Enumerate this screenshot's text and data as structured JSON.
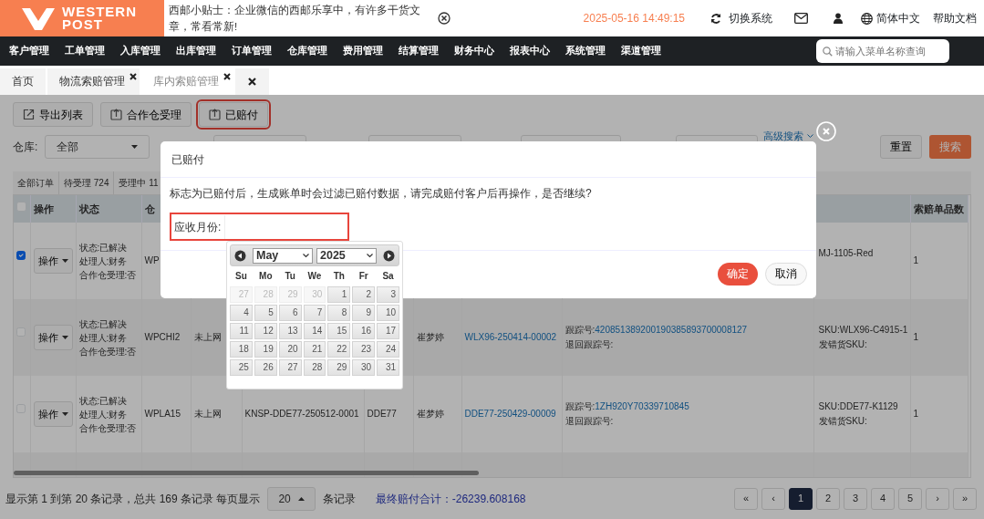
{
  "header": {
    "logo_line1": "WESTERN",
    "logo_line2": "POST",
    "tip": "西邮小贴士：企业微信的西邮乐享中，有许多干货文章，常看常新!",
    "datetime": "2025-05-16 14:49:15",
    "switch_system": "切换系统",
    "language": "简体中文",
    "help": "帮助文档"
  },
  "menu": [
    "客户管理",
    "工单管理",
    "入库管理",
    "出库管理",
    "订单管理",
    "仓库管理",
    "费用管理",
    "结算管理",
    "财务中心",
    "报表中心",
    "系统管理",
    "渠道管理"
  ],
  "menu_search": {
    "placeholder": "请输入菜单名称查询"
  },
  "page_tabs": [
    {
      "kind": "page",
      "label": "首页",
      "closable": false,
      "selected": false
    },
    {
      "kind": "page",
      "label": "物流索赔管理",
      "closable": true,
      "selected": false
    },
    {
      "kind": "page",
      "label": "库内索赔管理",
      "closable": true,
      "selected": true
    },
    {
      "kind": "close",
      "selected": false
    }
  ],
  "toolbar": [
    {
      "label": "导出列表",
      "highlighted": false
    },
    {
      "label": "合作仓受理",
      "highlighted": false
    },
    {
      "label": "已赔付",
      "highlighted": true
    }
  ],
  "filters": {
    "warehouse_label": "仓库:",
    "warehouse_value": "全部",
    "advanced_search": "高级搜索",
    "reset": "重置",
    "search": "搜索"
  },
  "status_tabs": [
    "全部订单",
    "待受理 724",
    "受理中 11"
  ],
  "table": {
    "select_all_checked": false,
    "columns": [
      null,
      "操作",
      "状态",
      "仓",
      null,
      null,
      null,
      null,
      null,
      null,
      null,
      "索赔单品数"
    ],
    "rows": [
      {
        "checked": true,
        "action": "操作",
        "status_lines": [
          "状态:已解决",
          "处理人:财务",
          "合作仓受理:否"
        ],
        "warehouse": "WP",
        "sku_lines": [
          "MJ-1105-Red"
        ],
        "qty": "1"
      },
      {
        "checked": false,
        "action": "操作",
        "status_lines": [
          "状态:已解决",
          "处理人:财务",
          "合作仓受理:否"
        ],
        "warehouse": "WPCHI2",
        "online": "未上网",
        "customer": "崔梦婷",
        "order_no": "WLX96-250414-00002",
        "tracking_label": "跟踪号:",
        "tracking_no": "420851389200190385893700008127",
        "return_label": "退回跟踪号:",
        "sku_lines": [
          "SKU:WLX96-C4915-1",
          "发错货SKU:"
        ],
        "qty": "1"
      },
      {
        "checked": false,
        "action": "操作",
        "status_lines": [
          "状态:已解决",
          "处理人:财务",
          "合作仓受理:否"
        ],
        "warehouse": "WPLA15",
        "online": "未上网",
        "claim_no": "KNSP-DDE77-250512-0001",
        "client": "DDE77",
        "customer": "崔梦婷",
        "order_no": "DDE77-250429-00009",
        "tracking_label": "跟踪号:",
        "tracking_no": "1ZH920Y70339710845",
        "return_label": "退回跟踪号:",
        "sku_lines": [
          "SKU:DDE77-K1129",
          "发错货SKU:"
        ],
        "qty": "1"
      }
    ]
  },
  "footer": {
    "summary_before": "显示第 1 到第 20 条记录，总共 169 条记录 每页显示",
    "page_size": "20",
    "summary_after": "条记录",
    "total": "最终赔付合计：-26239.608168"
  },
  "pagination": [
    {
      "label": "«",
      "selected": false
    },
    {
      "label": "‹",
      "selected": false
    },
    {
      "label": "1",
      "selected": true
    },
    {
      "label": "2",
      "selected": false
    },
    {
      "label": "3",
      "selected": false
    },
    {
      "label": "4",
      "selected": false
    },
    {
      "label": "5",
      "selected": false
    },
    {
      "label": "›",
      "selected": false
    },
    {
      "label": "»",
      "selected": false
    }
  ],
  "modal": {
    "title": "已赔付",
    "message": "标志为已赔付后，生成账单时会过滤已赔付数据，请完成赔付客户后再操作，是否继续?",
    "field_label": "应收月份:",
    "confirm": "确定",
    "cancel": "取消"
  },
  "datepicker": {
    "month": "May",
    "year": "2025",
    "weekdays": [
      "Su",
      "Mo",
      "Tu",
      "We",
      "Th",
      "Fr",
      "Sa"
    ],
    "days": [
      {
        "label": "27",
        "other_month": true
      },
      {
        "label": "28",
        "other_month": true
      },
      {
        "label": "29",
        "other_month": true
      },
      {
        "label": "30",
        "other_month": true
      },
      {
        "label": "1",
        "other_month": false
      },
      {
        "label": "2",
        "other_month": false
      },
      {
        "label": "3",
        "other_month": false
      },
      {
        "label": "4",
        "other_month": false
      },
      {
        "label": "5",
        "other_month": false
      },
      {
        "label": "6",
        "other_month": false
      },
      {
        "label": "7",
        "other_month": false
      },
      {
        "label": "8",
        "other_month": false
      },
      {
        "label": "9",
        "other_month": false
      },
      {
        "label": "10",
        "other_month": false
      },
      {
        "label": "11",
        "other_month": false
      },
      {
        "label": "12",
        "other_month": false
      },
      {
        "label": "13",
        "other_month": false
      },
      {
        "label": "14",
        "other_month": false
      },
      {
        "label": "15",
        "other_month": false
      },
      {
        "label": "16",
        "other_month": false
      },
      {
        "label": "17",
        "other_month": false
      },
      {
        "label": "18",
        "other_month": false
      },
      {
        "label": "19",
        "other_month": false
      },
      {
        "label": "20",
        "other_month": false
      },
      {
        "label": "21",
        "other_month": false
      },
      {
        "label": "22",
        "other_month": false
      },
      {
        "label": "23",
        "other_month": false
      },
      {
        "label": "24",
        "other_month": false
      },
      {
        "label": "25",
        "other_month": false
      },
      {
        "label": "26",
        "other_month": false
      },
      {
        "label": "27",
        "other_month": false
      },
      {
        "label": "28",
        "other_month": false
      },
      {
        "label": "29",
        "other_month": false
      },
      {
        "label": "30",
        "other_month": false
      },
      {
        "label": "31",
        "other_month": false
      }
    ]
  }
}
